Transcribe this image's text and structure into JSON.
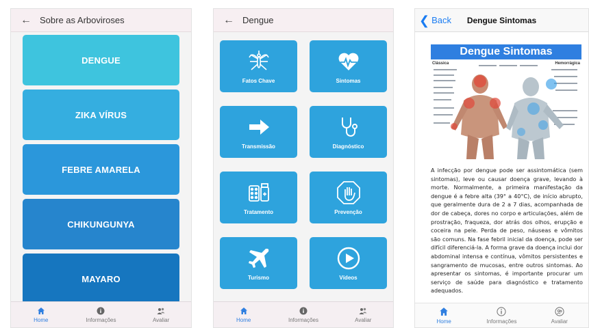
{
  "screen1": {
    "title": "Sobre as Arboviroses",
    "items": [
      {
        "label": "DENGUE",
        "color": "#3ec4de"
      },
      {
        "label": "ZIKA VÍRUS",
        "color": "#35aee0"
      },
      {
        "label": "FEBRE AMARELA",
        "color": "#2b97db"
      },
      {
        "label": "CHIKUNGUNYA",
        "color": "#2685cd"
      },
      {
        "label": "MAYARO",
        "color": "#1676bf"
      }
    ]
  },
  "screen2": {
    "title": "Dengue",
    "tiles": [
      {
        "label": "Fatos Chave",
        "icon": "mosquito-icon"
      },
      {
        "label": "Sintomas",
        "icon": "heartbeat-icon"
      },
      {
        "label": "Transmissão",
        "icon": "arrow-right-icon"
      },
      {
        "label": "Diagnóstico",
        "icon": "stethoscope-icon"
      },
      {
        "label": "Tratamento",
        "icon": "medicine-icon"
      },
      {
        "label": "Prevenção",
        "icon": "stop-hand-icon"
      },
      {
        "label": "Turismo",
        "icon": "airplane-icon"
      },
      {
        "label": "Vídeos",
        "icon": "play-icon"
      }
    ]
  },
  "screen3": {
    "back_label": "Back",
    "title": "Dengue Sintomas",
    "poster_title": "Dengue Sintomas",
    "poster_left_label": "Clássica",
    "poster_right_label": "Hemorrágica",
    "body": "A infecção por dengue pode ser assintomática (sem sintomas), leve ou causar doença grave, levando à morte. Normalmente, a primeira manifestação da dengue é a febre alta (39° a 40°C), de início abrupto, que geralmente dura de 2 a 7 dias, acompanhada de dor de cabeça, dores no corpo e articulações, além de prostração, fraqueza, dor atrás dos olhos, erupção e coceira na pele. Perda de peso, náuseas e vômitos são comuns. Na fase febril inicial da doença, pode ser difícil diferenciá-la. A forma grave da doença inclui dor abdominal intensa e contínua, vômitos persistentes e sangramento de mucosas, entre outros sintomas. Ao apresentar os sintomas, é importante procurar um serviço de saúde para diagnóstico e tratamento adequados."
  },
  "tabs": {
    "home": "Home",
    "info": "Informações",
    "rate": "Avaliar"
  },
  "colors": {
    "tile": "#2ea3dd",
    "active_tab": "#2f7fe0"
  }
}
